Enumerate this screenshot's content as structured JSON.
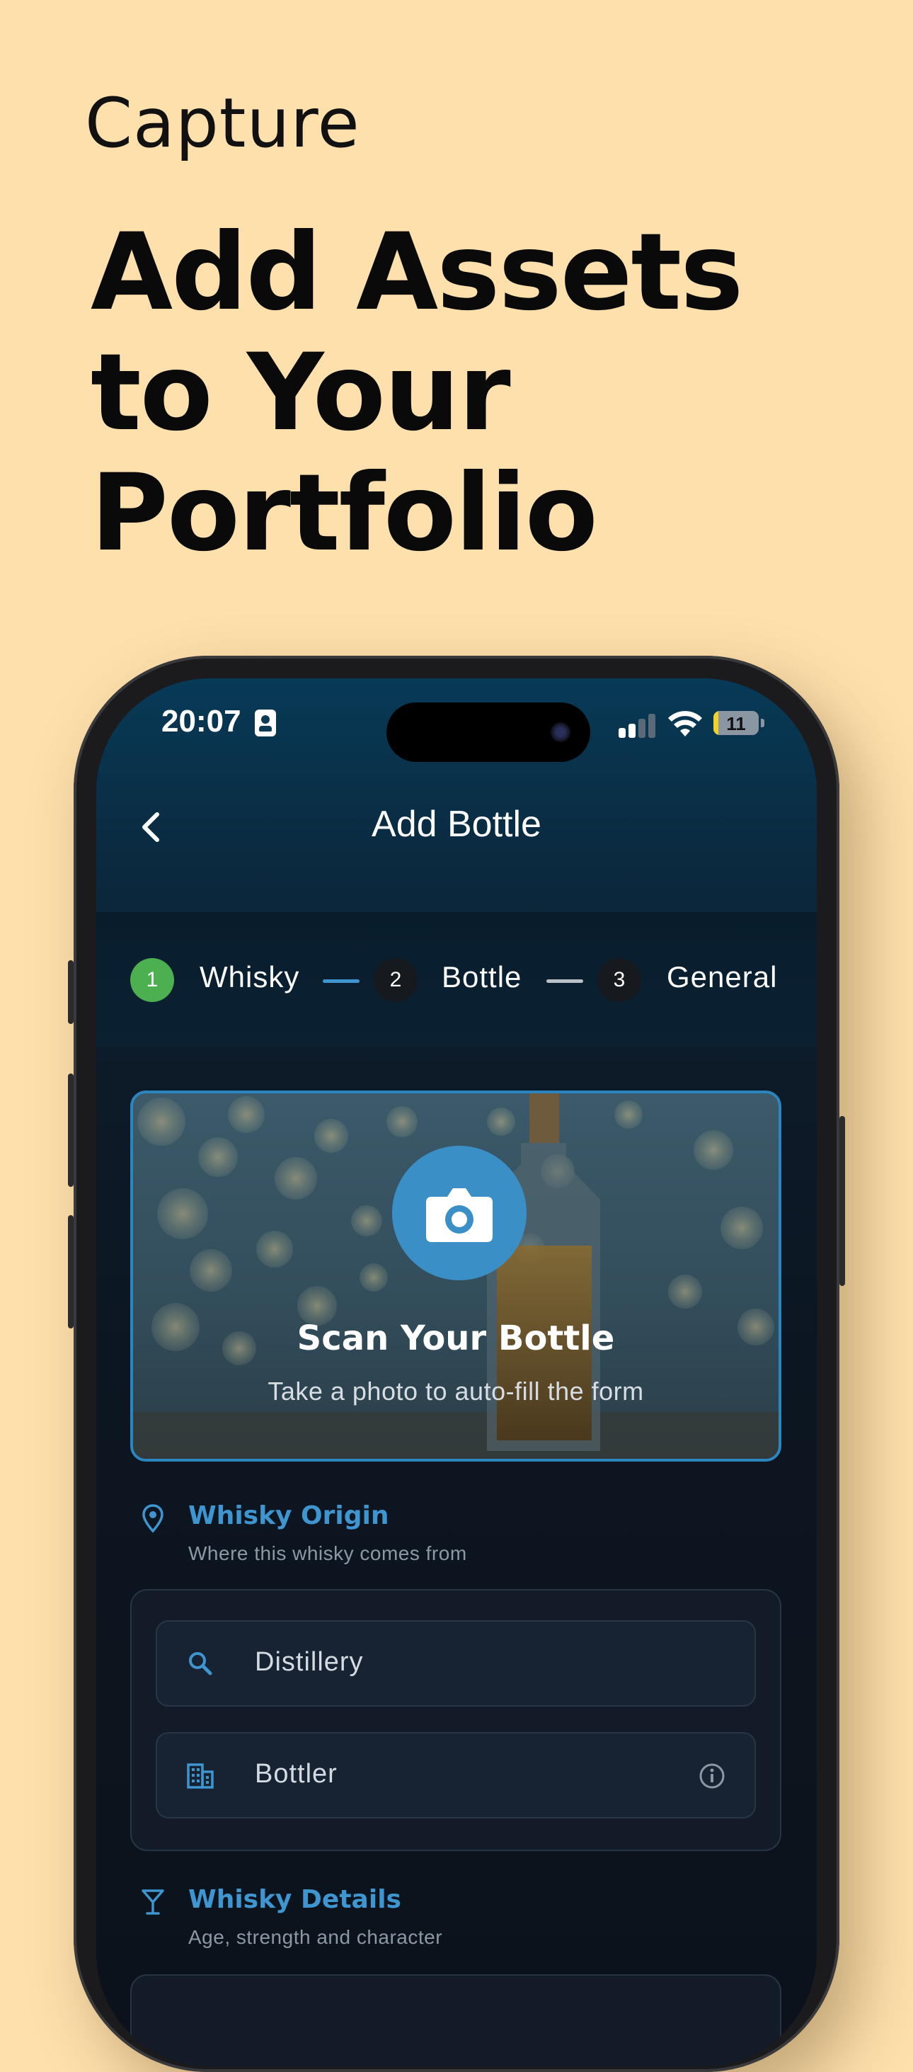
{
  "promo": {
    "eyebrow": "Capture",
    "headline_lines": [
      "Add Assets",
      "to Your",
      "Portfolio"
    ]
  },
  "status_bar": {
    "time": "20:07",
    "battery": "11",
    "battery_level": 0.11
  },
  "nav": {
    "title": "Add Bottle"
  },
  "stepper": {
    "steps": [
      {
        "number": "1",
        "label": "Whisky",
        "state": "active"
      },
      {
        "number": "2",
        "label": "Bottle",
        "state": "pending"
      },
      {
        "number": "3",
        "label": "General",
        "state": "pending"
      }
    ]
  },
  "scan": {
    "title": "Scan Your Bottle",
    "subtitle": "Take a photo to auto-fill the form"
  },
  "origin_section": {
    "title": "Whisky Origin",
    "subtitle": "Where this whisky comes from",
    "fields": [
      {
        "value": "Distillery",
        "icon": "search-icon"
      },
      {
        "value": "Bottler",
        "icon": "building-icon",
        "trailing_icon": "info-icon"
      }
    ]
  },
  "details_section": {
    "title": "Whisky Details",
    "subtitle": "Age, strength and character"
  },
  "colors": {
    "background": "#fde0ac",
    "accent_blue": "#3e95cf",
    "step_active": "#4caf50"
  }
}
